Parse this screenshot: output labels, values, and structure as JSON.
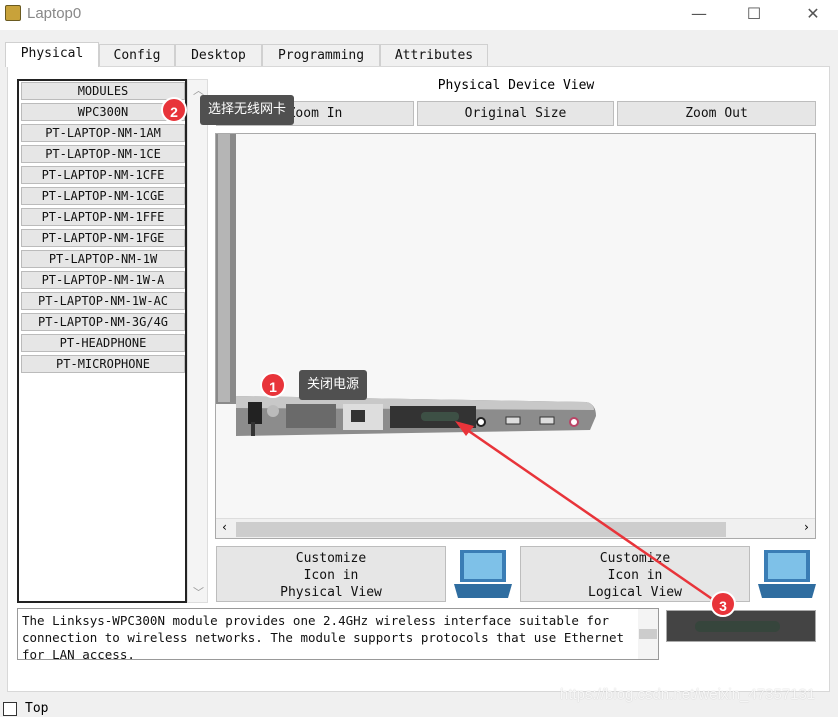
{
  "window": {
    "title": "Laptop0",
    "minimize": "—",
    "maximize": "☐",
    "close": "✕"
  },
  "tabs": [
    {
      "label": "Physical",
      "active": true
    },
    {
      "label": "Config"
    },
    {
      "label": "Desktop"
    },
    {
      "label": "Programming"
    },
    {
      "label": "Attributes"
    }
  ],
  "modules": [
    "MODULES",
    "WPC300N",
    "PT-LAPTOP-NM-1AM",
    "PT-LAPTOP-NM-1CE",
    "PT-LAPTOP-NM-1CFE",
    "PT-LAPTOP-NM-1CGE",
    "PT-LAPTOP-NM-1FFE",
    "PT-LAPTOP-NM-1FGE",
    "PT-LAPTOP-NM-1W",
    "PT-LAPTOP-NM-1W-A",
    "PT-LAPTOP-NM-1W-AC",
    "PT-LAPTOP-NM-3G/4G",
    "PT-HEADPHONE",
    "PT-MICROPHONE"
  ],
  "view": {
    "title": "Physical Device View",
    "zoom_in": "Zoom In",
    "original": "Original Size",
    "zoom_out": "Zoom Out"
  },
  "customize": {
    "physical": "Customize\nIcon in\nPhysical View",
    "logical": "Customize\nIcon in\nLogical View"
  },
  "description": "The Linksys-WPC300N module provides one 2.4GHz wireless interface suitable for connection to wireless networks. The module supports protocols that use Ethernet for LAN access.",
  "annotations": [
    {
      "num": "1",
      "text": "关闭电源"
    },
    {
      "num": "2",
      "text": "选择无线网卡"
    },
    {
      "num": "3"
    }
  ],
  "top_checkbox": {
    "label": "Top",
    "checked": false
  },
  "watermark": "https://blog.csdn.net/weixin_47357131",
  "colors": {
    "annotation": "#e8343a",
    "arrow": "#e8343a"
  }
}
